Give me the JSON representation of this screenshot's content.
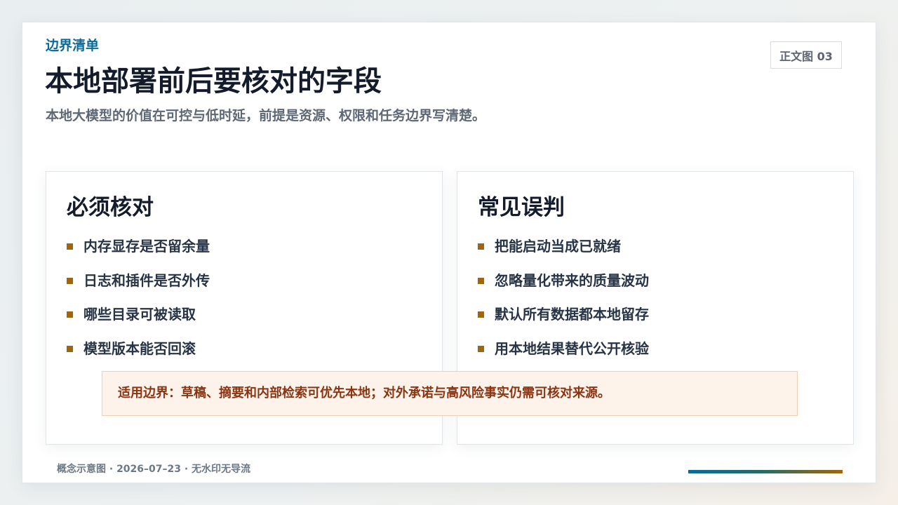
{
  "header": {
    "eyebrow": "边界清单",
    "figure_tag": "正文图 03",
    "title": "本地部署前后要核对的字段",
    "subtitle": "本地大模型的价值在可控与低时延，前提是资源、权限和任务边界写清楚。"
  },
  "cards": [
    {
      "title": "必须核对",
      "items": [
        "内存显存是否留余量",
        "日志和插件是否外传",
        "哪些目录可被读取",
        "模型版本能否回滚"
      ]
    },
    {
      "title": "常见误判",
      "items": [
        "把能启动当成已就绪",
        "忽略量化带来的质量波动",
        "默认所有数据都本地留存",
        "用本地结果替代公开核验"
      ]
    }
  ],
  "note": {
    "text": "适用边界：草稿、摘要和内部检索可优先本地；对外承诺与高风险事实仍需可核对来源。"
  },
  "footer": {
    "text": "概念示意图 · 2026–07–23 · 无水印无导流"
  },
  "colors": {
    "accent_blue": "#0b6b98",
    "bullet_brown": "#a0660e",
    "note_background": "#fdf3ea",
    "note_text": "#8a3412"
  }
}
